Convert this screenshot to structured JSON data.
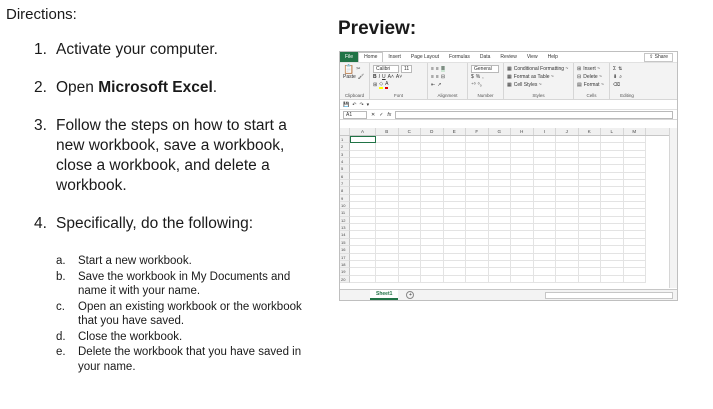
{
  "heading": "Directions:",
  "steps": [
    {
      "num": "1.",
      "text": "Activate your computer."
    },
    {
      "num": "2.",
      "pre": "Open ",
      "bold": "Microsoft Excel",
      "post": "."
    },
    {
      "num": "3.",
      "text": "Follow the steps on how to start a new workbook, save a workbook, close a workbook, and delete a workbook."
    },
    {
      "num": "4.",
      "text": "Specifically, do the following:"
    }
  ],
  "substeps": [
    {
      "letter": "a.",
      "text": "Start a new workbook."
    },
    {
      "letter": "b.",
      "text": "Save the workbook in My Documents and name it with your name."
    },
    {
      "letter": "c.",
      "text": "Open an existing workbook or the workbook that you have saved."
    },
    {
      "letter": "d.",
      "text": "Close the workbook."
    },
    {
      "letter": "e.",
      "text": "Delete the workbook that you have saved in your name."
    }
  ],
  "preview_title": "Preview:",
  "excel": {
    "tabs": [
      "File",
      "Home",
      "Insert",
      "Page Layout",
      "Formulas",
      "Data",
      "Review",
      "View",
      "Help"
    ],
    "share": "Share",
    "groups": {
      "clipboard": "Clipboard",
      "font": "Font",
      "alignment": "Alignment",
      "number": "Number",
      "styles": "Styles",
      "cells": "Cells",
      "editing": "Editing"
    },
    "paste": "Paste",
    "font_name": "Calibri",
    "font_size": "11",
    "number_format": "General",
    "styles_items": [
      "Conditional Formatting ~",
      "Format as Table ~",
      "Cell Styles ~"
    ],
    "cells_items": [
      "Insert ~",
      "Delete ~",
      "Format ~"
    ],
    "name_box": "A1",
    "fx": "fx",
    "columns": [
      "A",
      "B",
      "C",
      "D",
      "E",
      "F",
      "G",
      "H",
      "I",
      "J",
      "K",
      "L",
      "M"
    ],
    "rows": [
      "1",
      "2",
      "3",
      "4",
      "5",
      "6",
      "7",
      "8",
      "9",
      "10",
      "11",
      "12",
      "13",
      "14",
      "15",
      "16",
      "17",
      "18",
      "19",
      "20"
    ],
    "sheet_tab": "Sheet1",
    "accent": "#217346"
  }
}
